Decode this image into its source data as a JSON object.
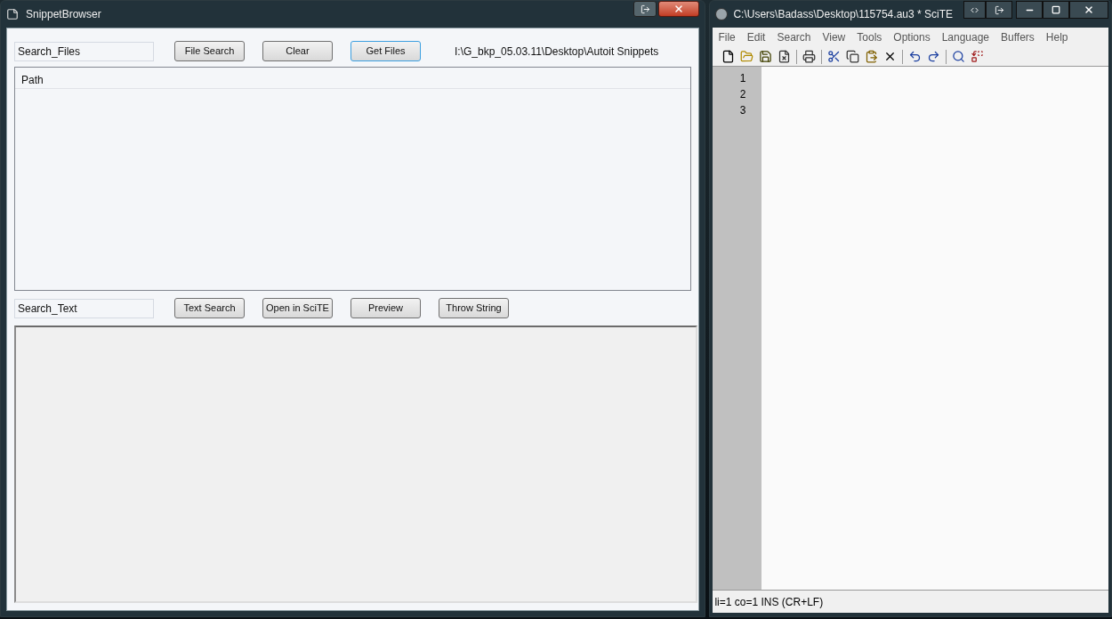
{
  "snippet_browser": {
    "window": {
      "title": "SnippetBrowser"
    },
    "search_files": {
      "value": "Search_Files"
    },
    "file_buttons": [
      {
        "label": "File Search",
        "focused": false
      },
      {
        "label": "Clear",
        "focused": false
      },
      {
        "label": "Get Files",
        "focused": true
      }
    ],
    "folder_path": "I:\\G_bkp_05.03.11\\Desktop\\Autoit Snippets",
    "file_list": {
      "columns": [
        "Path"
      ]
    },
    "search_text": {
      "value": "Search_Text"
    },
    "text_buttons": [
      {
        "label": "Text Search",
        "focused": false
      },
      {
        "label": "Open in SciTE",
        "focused": false
      },
      {
        "label": "Preview",
        "focused": false
      },
      {
        "label": "Throw String",
        "focused": false
      }
    ]
  },
  "scite": {
    "window": {
      "title": "C:\\Users\\Badass\\Desktop\\115754.au3 * SciTE"
    },
    "menu": [
      "File",
      "Edit",
      "Search",
      "View",
      "Tools",
      "Options",
      "Language",
      "Buffers",
      "Help"
    ],
    "line_numbers": [
      "1",
      "2",
      "3"
    ],
    "status_bar": "li=1 co=1 INS (CR+LF)"
  }
}
